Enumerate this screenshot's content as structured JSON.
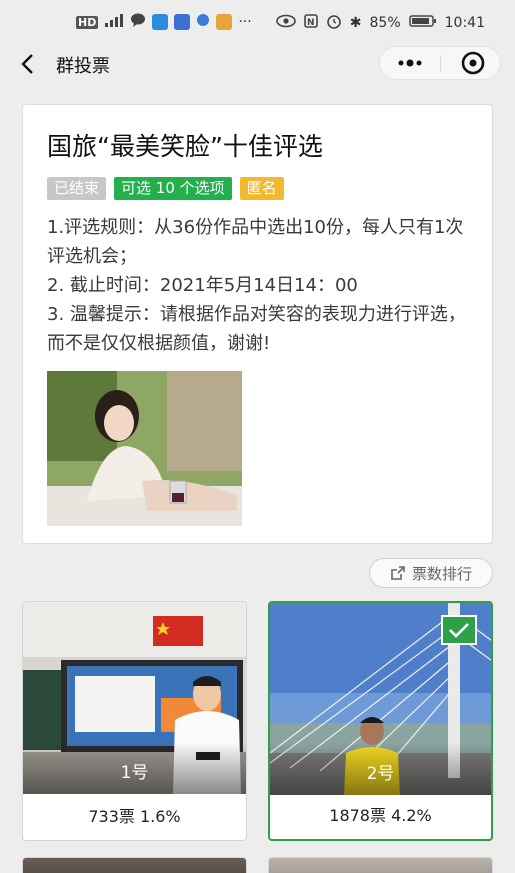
{
  "status_bar": {
    "left_label": "HD",
    "battery": "85%",
    "time": "10:41"
  },
  "nav": {
    "title": "群投票"
  },
  "poll": {
    "title": "国旅“最美笑脸”十佳评选",
    "tags": [
      "已结束",
      "可选 10 个选项",
      "匿名"
    ],
    "rules": [
      "1.评选规则：从36份作品中选出10份，每人只有1次评选机会；",
      "2. 截止时间：2021年5月14日14：00",
      "3. 温馨提示：请根据作品对笑容的表现力进行评选，而不是仅仅根据颜值，谢谢!"
    ]
  },
  "rank_button": {
    "label": "票数排行"
  },
  "items": [
    {
      "label": "1号",
      "stats": "733票 1.6%",
      "selected": false
    },
    {
      "label": "2号",
      "stats": "1878票 4.2%",
      "selected": true
    }
  ],
  "colors": {
    "accent_green": "#21b04b",
    "tag_yellow": "#f3b82f",
    "tag_gray": "#c7c7c7"
  }
}
